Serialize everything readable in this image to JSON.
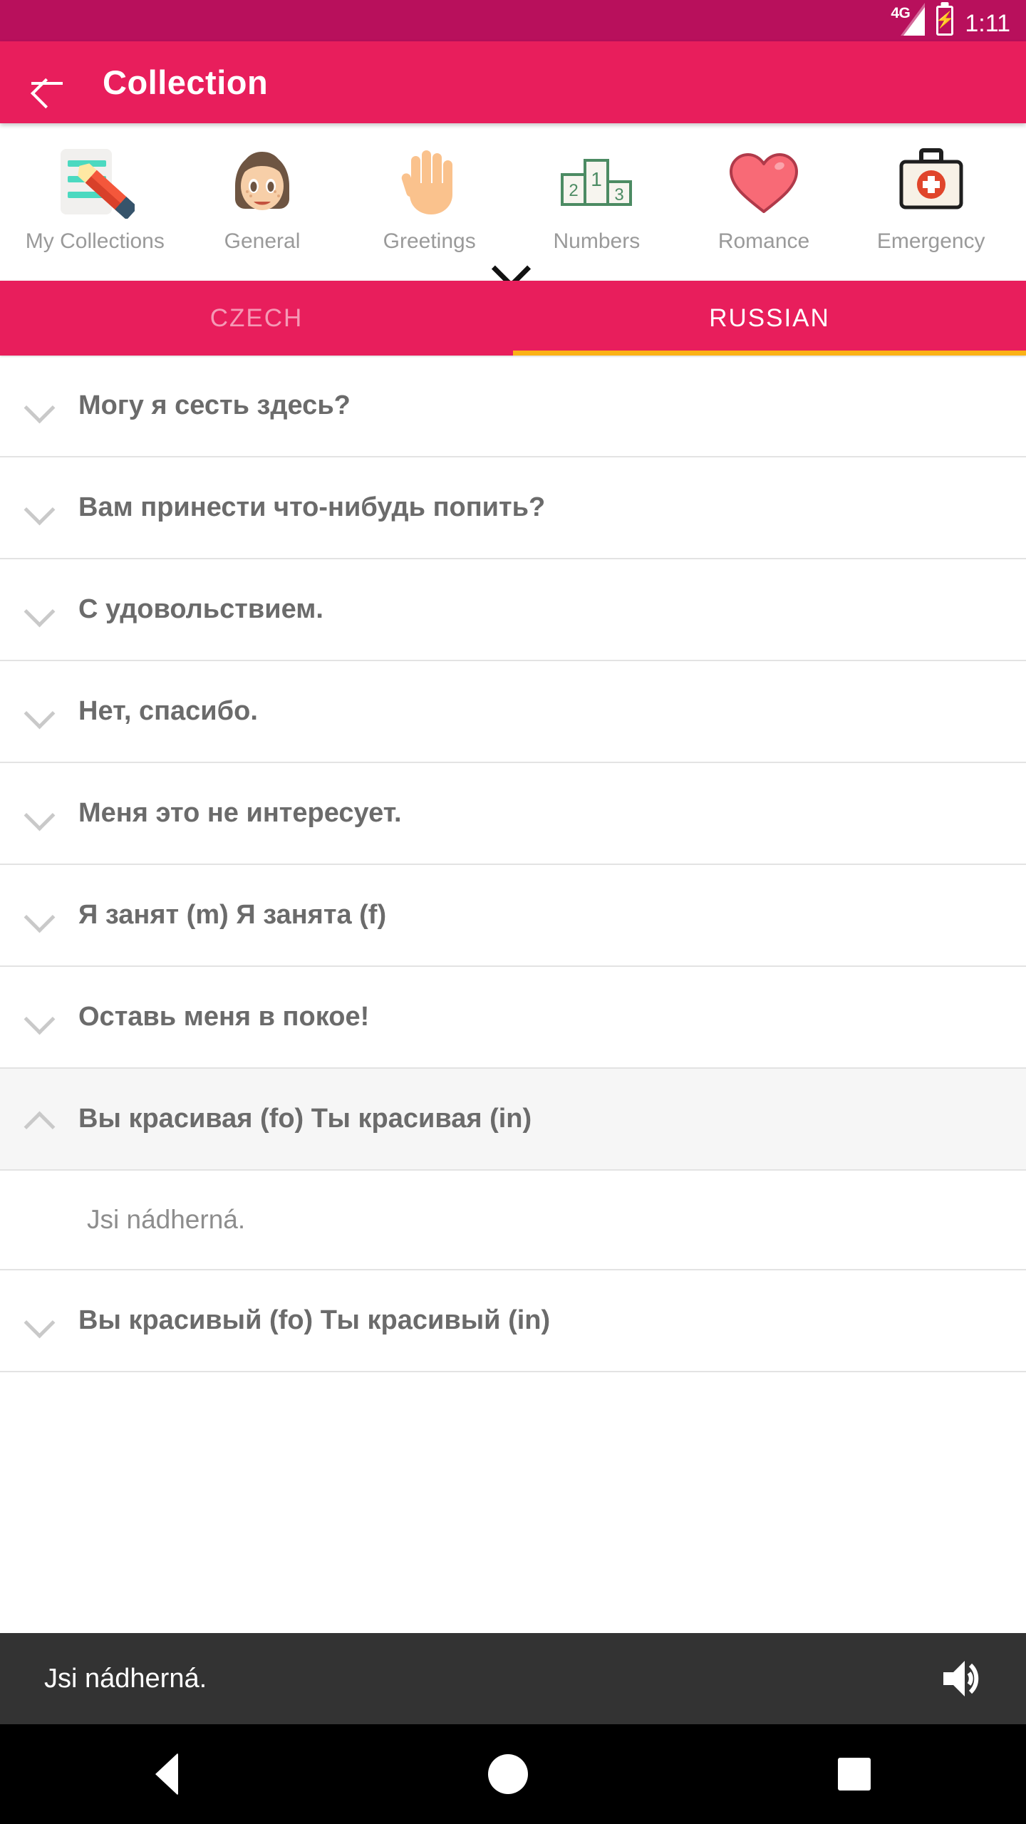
{
  "status_bar": {
    "network": "4G",
    "battery_icon": "battery-charging-icon",
    "time": "1:11"
  },
  "app_bar": {
    "back_icon": "back-arrow-icon",
    "title": "Collection"
  },
  "categories": {
    "expand_icon": "chevron-down-icon",
    "items": [
      {
        "label": "My Collections",
        "icon": "notepad-pencil-icon"
      },
      {
        "label": "General",
        "icon": "girl-face-icon"
      },
      {
        "label": "Greetings",
        "icon": "raised-hand-icon"
      },
      {
        "label": "Numbers",
        "icon": "podium-123-icon"
      },
      {
        "label": "Romance",
        "icon": "heart-icon"
      },
      {
        "label": "Emergency",
        "icon": "first-aid-kit-icon"
      }
    ]
  },
  "tabs": {
    "items": [
      {
        "label": "CZECH",
        "active": false
      },
      {
        "label": "RUSSIAN",
        "active": true
      }
    ],
    "indicator_color": "#FBB216"
  },
  "phrases": [
    {
      "text": "Могу я сесть здесь?",
      "expanded": false
    },
    {
      "text": "Вам принести что-нибудь попить?",
      "expanded": false
    },
    {
      "text": "С удовольствием.",
      "expanded": false
    },
    {
      "text": "Нет, спасибо.",
      "expanded": false
    },
    {
      "text": "Меня это не интересует.",
      "expanded": false
    },
    {
      "text": "Я занят (m)  Я занята (f)",
      "expanded": false
    },
    {
      "text": "Оставь меня в покое!",
      "expanded": false
    },
    {
      "text": "Вы красивая (fo)  Ты красивая (in)",
      "expanded": true,
      "translation": "Jsi nádherná."
    },
    {
      "text": "Вы красивый (fo)  Ты красивый (in)",
      "expanded": false
    }
  ],
  "player": {
    "text": "Jsi nádherná.",
    "speaker_icon": "volume-up-icon"
  },
  "navbar": {
    "back": "nav-back-icon",
    "home": "nav-home-icon",
    "recents": "nav-recents-icon"
  },
  "colors": {
    "status_bar": "#B8105C",
    "app_bar": "#E81E5C",
    "accent": "#FBB216",
    "player_bg": "#333333"
  }
}
